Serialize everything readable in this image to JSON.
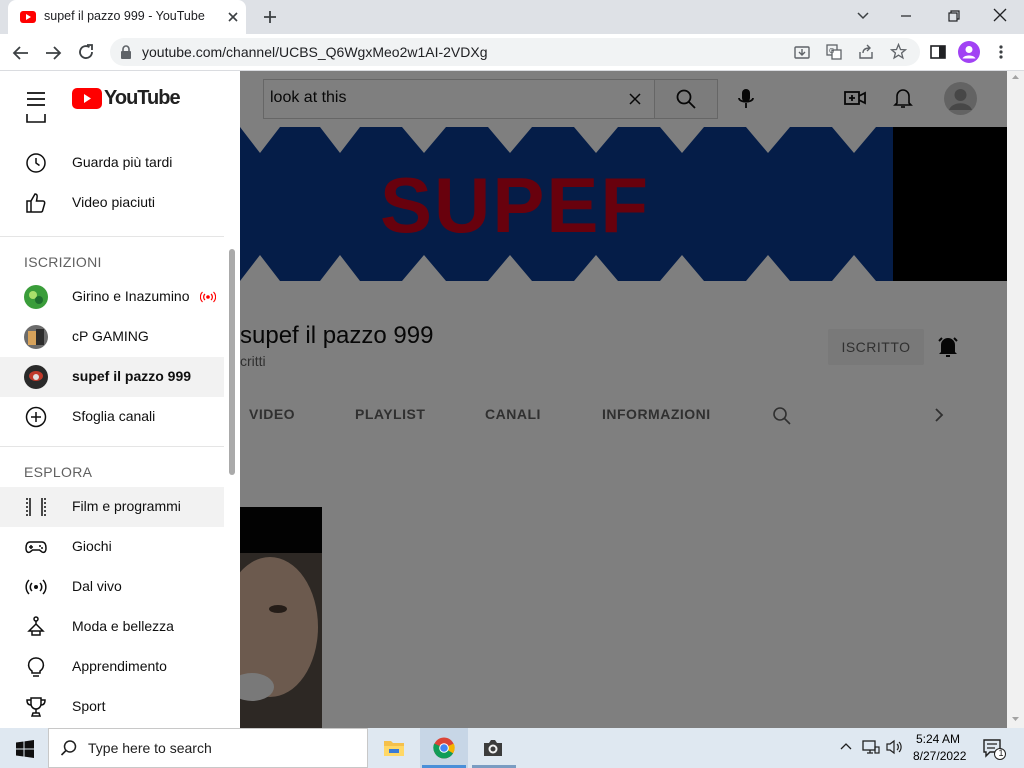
{
  "browser": {
    "tab_title": "supef il pazzo 999 - YouTube",
    "url": "youtube.com/channel/UCBS_Q6WgxMeo2w1AI-2VDXg"
  },
  "youtube": {
    "logo_text": "YouTube",
    "search_value": "look at this",
    "banner_text": "SUPEF",
    "channel_name": "supef il pazzo 999",
    "channel_subs": "critti",
    "subscribed_label": "ISCRITTO",
    "channel_tabs": [
      "VIDEO",
      "PLAYLIST",
      "CANALI",
      "INFORMAZIONI"
    ]
  },
  "sidebar": {
    "top_items": [
      {
        "label": "Guarda più tardi",
        "icon": "clock-icon"
      },
      {
        "label": "Video piaciuti",
        "icon": "thumb-up-icon"
      }
    ],
    "subscriptions_heading": "ISCRIZIONI",
    "subscriptions": [
      {
        "label": "Girino e Inazumino",
        "live": true
      },
      {
        "label": "cP GAMING",
        "live": false
      },
      {
        "label": "supef il pazzo 999",
        "live": false,
        "active": true
      },
      {
        "label": "Sfoglia canali",
        "live": false
      }
    ],
    "explore_heading": "ESPLORA",
    "explore": [
      {
        "label": "Film e programmi",
        "icon": "film-icon"
      },
      {
        "label": "Giochi",
        "icon": "gamepad-icon"
      },
      {
        "label": "Dal vivo",
        "icon": "live-icon"
      },
      {
        "label": "Moda e bellezza",
        "icon": "hanger-icon"
      },
      {
        "label": "Apprendimento",
        "icon": "bulb-icon"
      },
      {
        "label": "Sport",
        "icon": "trophy-icon"
      }
    ]
  },
  "taskbar": {
    "search_placeholder": "Type here to search",
    "time": "5:24 AM",
    "date": "8/27/2022",
    "notification_count": "1"
  },
  "colors": {
    "youtube_red": "#ff0000",
    "banner_blue": "#0b3a91",
    "banner_text": "#d0021b"
  }
}
